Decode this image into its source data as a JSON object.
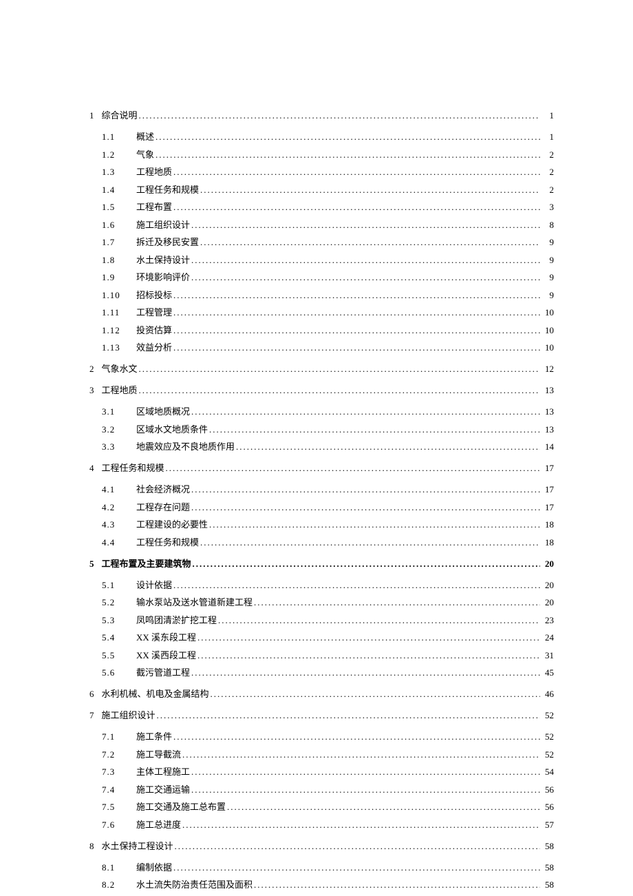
{
  "toc": [
    {
      "num": "1",
      "title": "综合说明",
      "page": "1",
      "level": 1,
      "children": [
        {
          "num": "1.1",
          "title": "概述",
          "page": "1"
        },
        {
          "num": "1.2",
          "title": "气象",
          "page": "2"
        },
        {
          "num": "1.3",
          "title": "工程地质",
          "page": "2"
        },
        {
          "num": "1.4",
          "title": "工程任务和规模",
          "page": "2"
        },
        {
          "num": "1.5",
          "title": "工程布置",
          "page": "3"
        },
        {
          "num": "1.6",
          "title": "施工组织设计",
          "page": "8"
        },
        {
          "num": "1.7",
          "title": "拆迁及移民安置",
          "page": "9"
        },
        {
          "num": "1.8",
          "title": "水土保持设计",
          "page": "9"
        },
        {
          "num": "1.9",
          "title": "环境影响评价",
          "page": "9"
        },
        {
          "num": "1.10",
          "title": "招标投标",
          "page": "9"
        },
        {
          "num": "1.11",
          "title": "工程管理",
          "page": "10"
        },
        {
          "num": "1.12",
          "title": "投资估算",
          "page": "10"
        },
        {
          "num": "1.13",
          "title": "效益分析",
          "page": "10"
        }
      ]
    },
    {
      "num": "2",
      "title": "气象水文",
      "page": "12",
      "level": 1,
      "children": []
    },
    {
      "num": "3",
      "title": "工程地质",
      "page": "13",
      "level": 1,
      "children": [
        {
          "num": "3.1",
          "title": "区域地质概况",
          "page": "13"
        },
        {
          "num": "3.2",
          "title": "区域水文地质条件",
          "page": "13"
        },
        {
          "num": "3.3",
          "title": "地震效应及不良地质作用",
          "page": "14"
        }
      ]
    },
    {
      "num": "4",
      "title": "工程任务和规模",
      "page": "17",
      "level": 1,
      "children": [
        {
          "num": "4.1",
          "title": "社会经济概况",
          "page": "17"
        },
        {
          "num": "4.2",
          "title": "工程存在问题",
          "page": "17"
        },
        {
          "num": "4.3",
          "title": "工程建设的必要性",
          "page": "18"
        },
        {
          "num": "4.4",
          "title": "工程任务和规模",
          "page": "18"
        }
      ]
    },
    {
      "num": "5",
      "title": "工程布置及主要建筑物",
      "page": "20",
      "level": 1,
      "bold": true,
      "children": [
        {
          "num": "5.1",
          "title": "设计依据",
          "page": "20"
        },
        {
          "num": "5.2",
          "title": "输水泵站及送水管道新建工程",
          "page": "20"
        },
        {
          "num": "5.3",
          "title": "凤鸣团清淤扩挖工程",
          "page": "23"
        },
        {
          "num": "5.4",
          "title": "XX 溪东段工程",
          "page": "24"
        },
        {
          "num": "5.5",
          "title": "XX 溪西段工程",
          "page": "31"
        },
        {
          "num": "5.6",
          "title": "截污管道工程",
          "page": "45"
        }
      ]
    },
    {
      "num": "6",
      "title": "水利机械、机电及金属结构",
      "page": "46",
      "level": 1,
      "children": []
    },
    {
      "num": "7",
      "title": "施工组织设计",
      "page": "52",
      "level": 1,
      "children": [
        {
          "num": "7.1",
          "title": "施工条件",
          "page": "52"
        },
        {
          "num": "7.2",
          "title": "施工导截流",
          "page": "52"
        },
        {
          "num": "7.3",
          "title": "主体工程施工",
          "page": "54"
        },
        {
          "num": "7.4",
          "title": "施工交通运输",
          "page": "56"
        },
        {
          "num": "7.5",
          "title": "施工交通及施工总布置",
          "page": "56"
        },
        {
          "num": "7.6",
          "title": "施工总进度",
          "page": "57"
        }
      ]
    },
    {
      "num": "8",
      "title": "水土保持工程设计",
      "page": "58",
      "level": 1,
      "children": [
        {
          "num": "8.1",
          "title": "编制依据",
          "page": "58"
        },
        {
          "num": "8.2",
          "title": "水土流失防治责任范围及面积",
          "page": "58"
        }
      ]
    }
  ]
}
